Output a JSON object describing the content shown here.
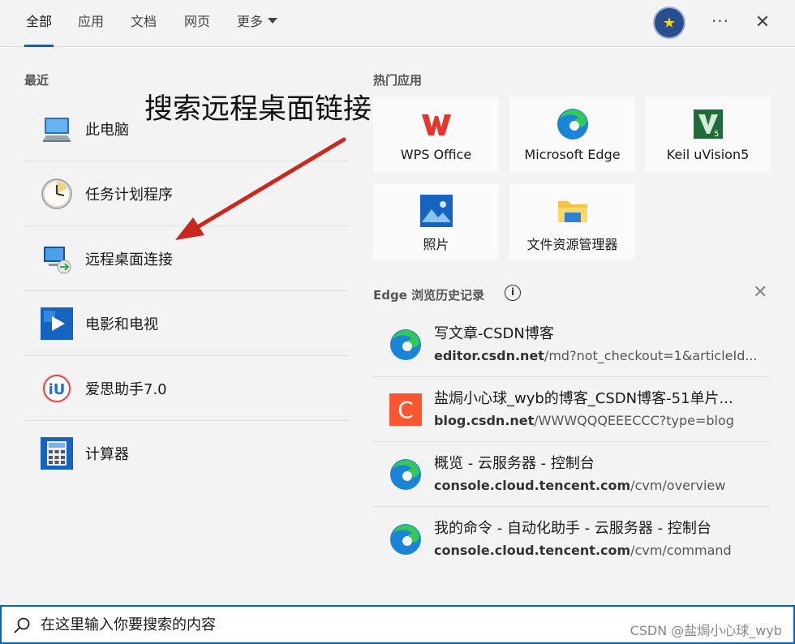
{
  "tabs": [
    {
      "label": "全部"
    },
    {
      "label": "应用"
    },
    {
      "label": "文档"
    },
    {
      "label": "网页"
    },
    {
      "label": "更多"
    }
  ],
  "recent": {
    "title": "最近",
    "items": [
      {
        "label": "此电脑",
        "icon": "computer-icon"
      },
      {
        "label": "任务计划程序",
        "icon": "clock-icon"
      },
      {
        "label": "远程桌面连接",
        "icon": "remote-desktop-icon"
      },
      {
        "label": "电影和电视",
        "icon": "play-icon"
      },
      {
        "label": "爱思助手7.0",
        "icon": "i4-icon"
      },
      {
        "label": "计算器",
        "icon": "calculator-icon"
      }
    ]
  },
  "annotation": "搜索远程桌面链接",
  "hot_apps": {
    "title": "热门应用",
    "items": [
      {
        "label": "WPS Office",
        "icon": "wps-icon"
      },
      {
        "label": "Microsoft Edge",
        "icon": "edge-icon"
      },
      {
        "label": "Keil uVision5",
        "icon": "keil-icon"
      },
      {
        "label": "照片",
        "icon": "photos-icon"
      },
      {
        "label": "文件资源管理器",
        "icon": "folder-icon"
      }
    ]
  },
  "history": {
    "title": "Edge 浏览历史记录",
    "info_glyph": "i",
    "items": [
      {
        "title": "写文章-CSDN博客",
        "domain": "editor.csdn.net",
        "path": "/md?not_checkout=1&articleId...",
        "icon": "edge-icon"
      },
      {
        "title": "盐焗小心球_wyb的博客_CSDN博客-51单片...",
        "domain": "blog.csdn.net",
        "path": "/WWWQQQEEECCC?type=blog",
        "icon": "csdn-icon"
      },
      {
        "title": "概览 - 云服务器 - 控制台",
        "domain": "console.cloud.tencent.com",
        "path": "/cvm/overview",
        "icon": "edge-icon"
      },
      {
        "title": "我的命令 - 自动化助手 - 云服务器 - 控制台",
        "domain": "console.cloud.tencent.com",
        "path": "/cvm/command",
        "icon": "edge-icon"
      }
    ]
  },
  "search": {
    "placeholder": "在这里输入你要搜索的内容"
  },
  "watermark": "CSDN @盐焗小心球_wyb",
  "colors": {
    "accent": "#0067c0",
    "annotation_arrow": "#c8281e"
  }
}
